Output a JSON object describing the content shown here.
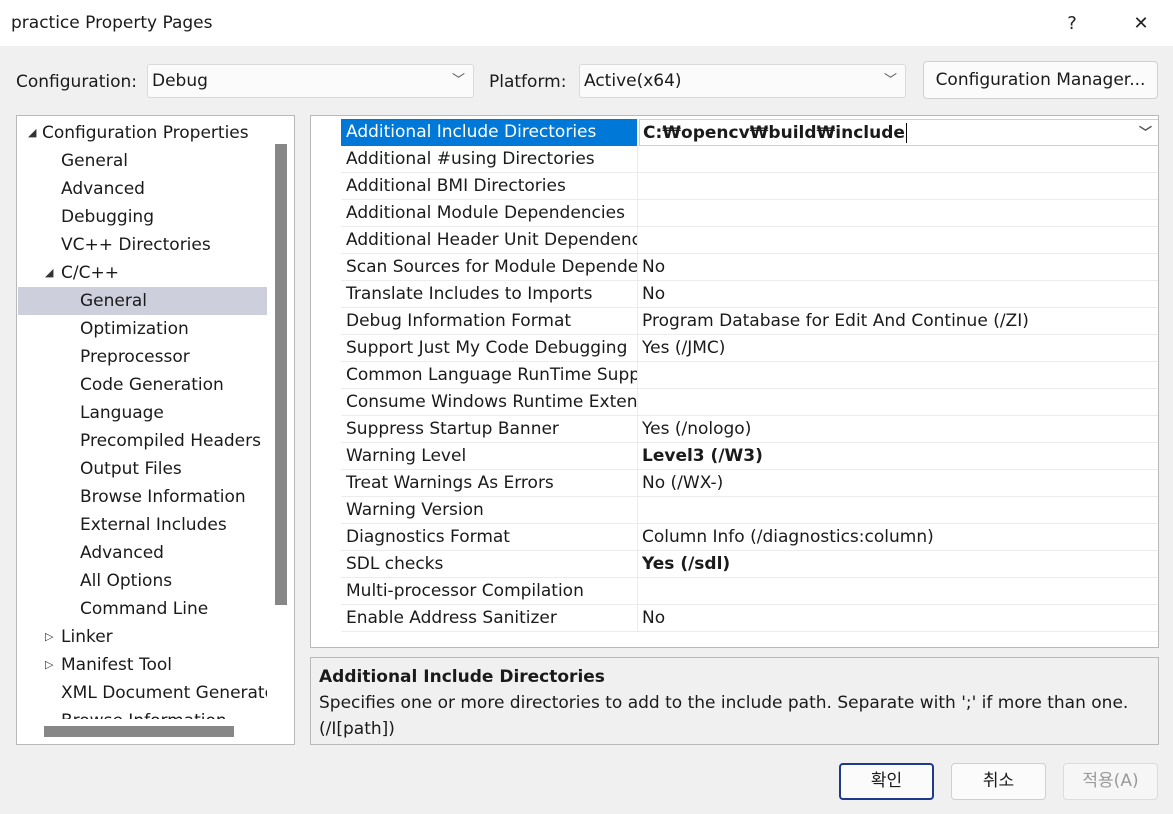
{
  "window": {
    "title": "practice Property Pages",
    "help_label": "?",
    "close_label": "✕"
  },
  "config": {
    "configuration_label": "Configuration:",
    "configuration_value": "Debug",
    "platform_label": "Platform:",
    "platform_value": "Active(x64)",
    "manager_button": "Configuration Manager..."
  },
  "tree": {
    "items": [
      {
        "label": "Configuration Properties",
        "arrow": "◢"
      },
      {
        "label": "General"
      },
      {
        "label": "Advanced"
      },
      {
        "label": "Debugging"
      },
      {
        "label": "VC++ Directories"
      },
      {
        "label": "C/C++",
        "arrow": "◢"
      },
      {
        "label": "General",
        "selected": true
      },
      {
        "label": "Optimization"
      },
      {
        "label": "Preprocessor"
      },
      {
        "label": "Code Generation"
      },
      {
        "label": "Language"
      },
      {
        "label": "Precompiled Headers"
      },
      {
        "label": "Output Files"
      },
      {
        "label": "Browse Information"
      },
      {
        "label": "External Includes"
      },
      {
        "label": "Advanced"
      },
      {
        "label": "All Options"
      },
      {
        "label": "Command Line"
      },
      {
        "label": "Linker",
        "arrow": "▷"
      },
      {
        "label": "Manifest Tool",
        "arrow": "▷"
      },
      {
        "label": "XML Document Generato",
        "arrow": "▷"
      },
      {
        "label": "Browse Information",
        "arrow": "▷"
      }
    ]
  },
  "properties": [
    {
      "name": "Additional Include Directories",
      "value": "C:₩opencv₩build₩include"
    },
    {
      "name": "Additional #using Directories",
      "value": ""
    },
    {
      "name": "Additional BMI Directories",
      "value": ""
    },
    {
      "name": "Additional Module Dependencies",
      "value": ""
    },
    {
      "name": "Additional Header Unit Dependencies",
      "value": ""
    },
    {
      "name": "Scan Sources for Module Dependencies",
      "value": "No"
    },
    {
      "name": "Translate Includes to Imports",
      "value": "No"
    },
    {
      "name": "Debug Information Format",
      "value": "Program Database for Edit And Continue (/ZI)"
    },
    {
      "name": "Support Just My Code Debugging",
      "value": "Yes (/JMC)"
    },
    {
      "name": "Common Language RunTime Support",
      "value": ""
    },
    {
      "name": "Consume Windows Runtime Extension",
      "value": ""
    },
    {
      "name": "Suppress Startup Banner",
      "value": "Yes (/nologo)"
    },
    {
      "name": "Warning Level",
      "value": "Level3 (/W3)"
    },
    {
      "name": "Treat Warnings As Errors",
      "value": "No (/WX-)"
    },
    {
      "name": "Warning Version",
      "value": ""
    },
    {
      "name": "Diagnostics Format",
      "value": "Column Info (/diagnostics:column)"
    },
    {
      "name": "SDL checks",
      "value": "Yes (/sdl)"
    },
    {
      "name": "Multi-processor Compilation",
      "value": ""
    },
    {
      "name": "Enable Address Sanitizer",
      "value": "No"
    }
  ],
  "description": {
    "title": "Additional Include Directories",
    "text": "Specifies one or more directories to add to the include path. Separate with ';' if more than one. (/I[path])"
  },
  "buttons": {
    "ok": "확인",
    "cancel": "취소",
    "apply": "적용(A)"
  }
}
